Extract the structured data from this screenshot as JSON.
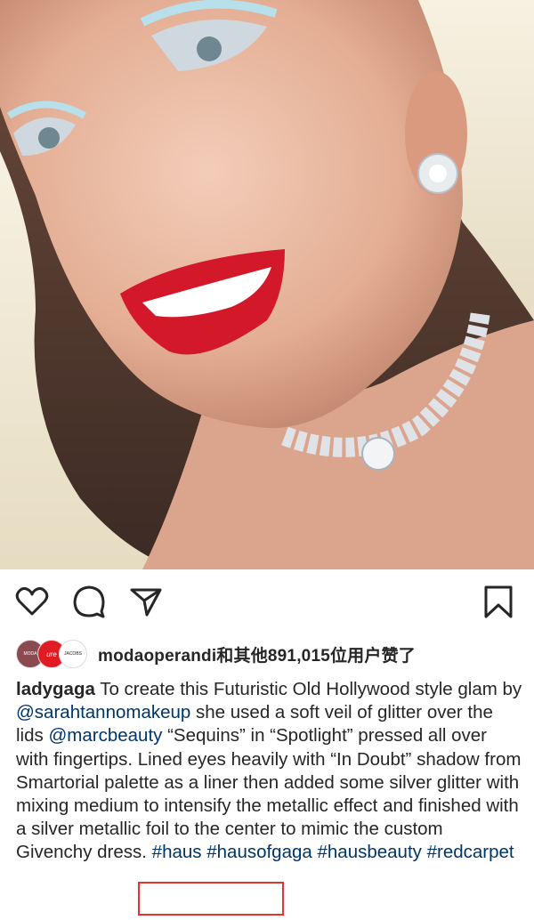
{
  "post_image": {
    "alt": "selfie photo",
    "colors": {
      "skin": "#e8b49c",
      "lips": "#d3182a",
      "hair": "#f1ead4",
      "bg": "#7a5a47"
    }
  },
  "actions": {
    "like_icon": "heart-icon",
    "comment_icon": "comment-icon",
    "share_icon": "send-icon",
    "save_icon": "bookmark-icon"
  },
  "likes": {
    "avatars": [
      {
        "label": "MODA"
      },
      {
        "label": "ure"
      },
      {
        "label": "JACOBS"
      }
    ],
    "text": "modaoperandi和其他891,015位用户赞了"
  },
  "caption": {
    "username": "ladygaga",
    "segments": [
      {
        "text": " To create this Futuristic Old Hollywood style glam by ",
        "tag": false
      },
      {
        "text": "@sarahtannomakeup",
        "tag": true
      },
      {
        "text": " she used a soft veil of glitter over the lids ",
        "tag": false
      },
      {
        "text": "@marcbeauty",
        "tag": true
      },
      {
        "text": " “Sequins” in “Spotlight” pressed all over with fingertips. Lined eyes heavily with “In Doubt” shadow from Smartorial palette as a liner then added some silver glitter with mixing medium to intensify the metallic effect and finished with a silver metallic foil to the center to mimic the custom Givenchy dress. ",
        "tag": false
      },
      {
        "text": "#haus",
        "tag": true
      },
      {
        "text": " ",
        "tag": false
      },
      {
        "text": "#hausofgaga",
        "tag": true
      },
      {
        "text": " ",
        "tag": false
      },
      {
        "text": "#hausbeauty",
        "tag": true
      },
      {
        "text": " ",
        "tag": false
      },
      {
        "text": "#redcarpet",
        "tag": true
      }
    ]
  },
  "colors": {
    "link": "#003569",
    "highlight_box": "#e8322d",
    "text": "#262626"
  }
}
